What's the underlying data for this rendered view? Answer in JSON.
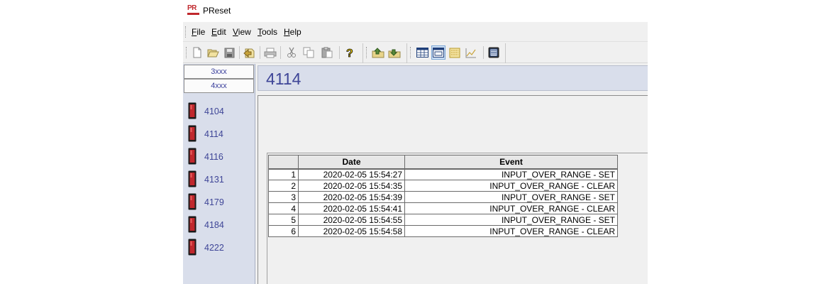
{
  "app": {
    "title": "PReset",
    "logo_text": "PR"
  },
  "menu": [
    {
      "label": "File",
      "key": "F",
      "rest": "ile"
    },
    {
      "label": "Edit",
      "key": "E",
      "rest": "dit"
    },
    {
      "label": "View",
      "key": "V",
      "rest": "iew"
    },
    {
      "label": "Tools",
      "key": "T",
      "rest": "ools"
    },
    {
      "label": "Help",
      "key": "H",
      "rest": "elp"
    }
  ],
  "toolbar": {
    "icons": [
      "new-icon",
      "open-icon",
      "save-icon",
      "wizard-icon",
      "print-icon",
      "cut-icon",
      "copy-icon",
      "paste-icon",
      "help-icon",
      "upload-icon",
      "download-icon",
      "grid-view-icon",
      "device-view-icon",
      "monitor-icon",
      "chart-icon",
      "display-icon"
    ],
    "active": "device-view-icon"
  },
  "sidebar": {
    "groups": [
      "3xxx",
      "4xxx"
    ],
    "devices": [
      "4104",
      "4114",
      "4116",
      "4131",
      "4179",
      "4184",
      "4222"
    ]
  },
  "content": {
    "header": "4114",
    "table": {
      "columns": [
        "",
        "Date",
        "Event"
      ],
      "rows": [
        [
          "1",
          "2020-02-05 15:54:27",
          "INPUT_OVER_RANGE - SET"
        ],
        [
          "2",
          "2020-02-05 15:54:35",
          "INPUT_OVER_RANGE - CLEAR"
        ],
        [
          "3",
          "2020-02-05 15:54:39",
          "INPUT_OVER_RANGE - SET"
        ],
        [
          "4",
          "2020-02-05 15:54:41",
          "INPUT_OVER_RANGE - CLEAR"
        ],
        [
          "5",
          "2020-02-05 15:54:55",
          "INPUT_OVER_RANGE - SET"
        ],
        [
          "6",
          "2020-02-05 15:54:58",
          "INPUT_OVER_RANGE - CLEAR"
        ]
      ]
    }
  },
  "colors": {
    "accent": "#3e4597",
    "panel": "#d9deeb",
    "brand": "#c0282d"
  }
}
